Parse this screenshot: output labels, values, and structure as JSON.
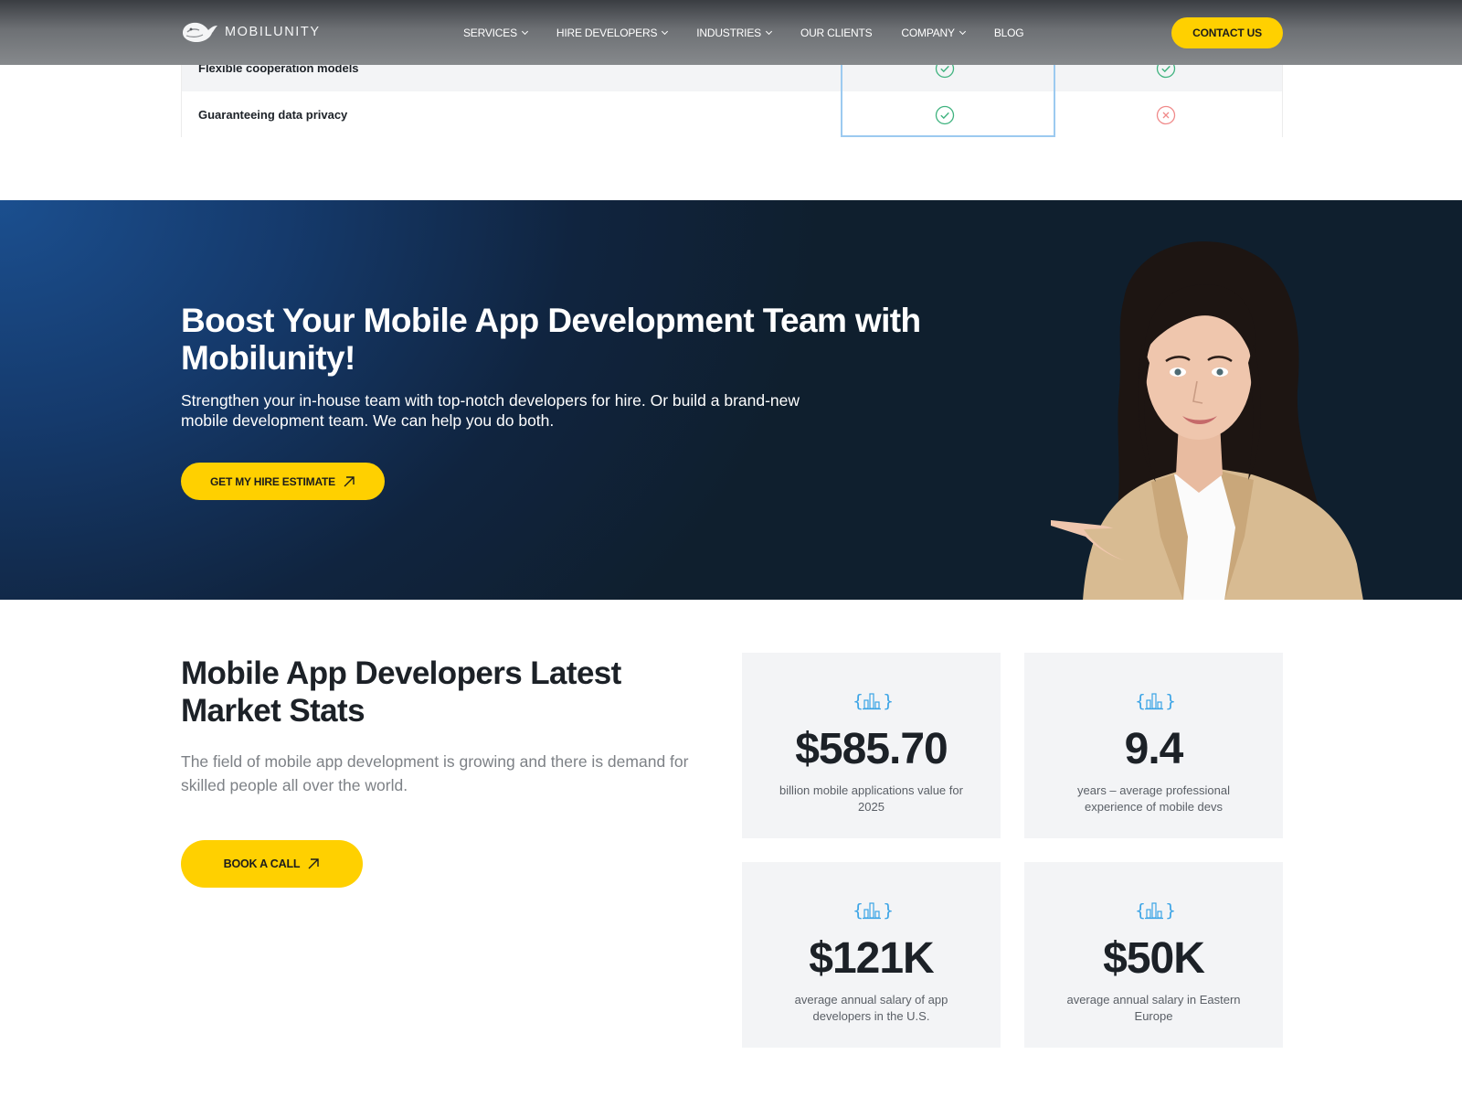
{
  "header": {
    "logo_text": "MOBILUNITY",
    "nav": [
      {
        "label": "SERVICES",
        "has_dropdown": true
      },
      {
        "label": "HIRE DEVELOPERS",
        "has_dropdown": true
      },
      {
        "label": "INDUSTRIES",
        "has_dropdown": true
      },
      {
        "label": "OUR CLIENTS",
        "has_dropdown": false
      },
      {
        "label": "COMPANY",
        "has_dropdown": true
      },
      {
        "label": "BLOG",
        "has_dropdown": false
      }
    ],
    "contact_label": "CONTACT US"
  },
  "comparison": {
    "rows": [
      {
        "label": "Flexible cooperation models",
        "mobilunity": "check",
        "other": "check"
      },
      {
        "label": "Guaranteeing data privacy",
        "mobilunity": "check",
        "other": "cross"
      }
    ]
  },
  "hero": {
    "title": "Boost Your Mobile App Development Team with Mobilunity!",
    "subtitle": "Strengthen your in-house team with top-notch developers for hire. Or build a brand-new mobile development team. We can help you do both.",
    "cta_label": "GET MY HIRE ESTIMATE"
  },
  "stats": {
    "title": "Mobile App Developers Latest Market Stats",
    "description": "The field of mobile app development is growing and there is demand for skilled people all over the world.",
    "cta_label": "BOOK A CALL",
    "cards": [
      {
        "value": "$585.70",
        "label": "billion mobile applications value for 2025"
      },
      {
        "value": "9.4",
        "label": "years – average professional experience of mobile devs"
      },
      {
        "value": "$121K",
        "label": "average annual salary of app developers in the U.S."
      },
      {
        "value": "$50K",
        "label": "average annual salary in Eastern Europe"
      }
    ]
  },
  "colors": {
    "accent_yellow": "#ffd000",
    "check_green": "#3fb37f",
    "cross_red": "#f08a8a",
    "icon_blue": "#3ba4e6",
    "hero_dark": "#10243f"
  },
  "icons": [
    "whale-logo-icon",
    "chevron-down-icon",
    "check-circle-icon",
    "cross-circle-icon",
    "arrow-up-right-icon",
    "bar-chart-braces-icon"
  ]
}
